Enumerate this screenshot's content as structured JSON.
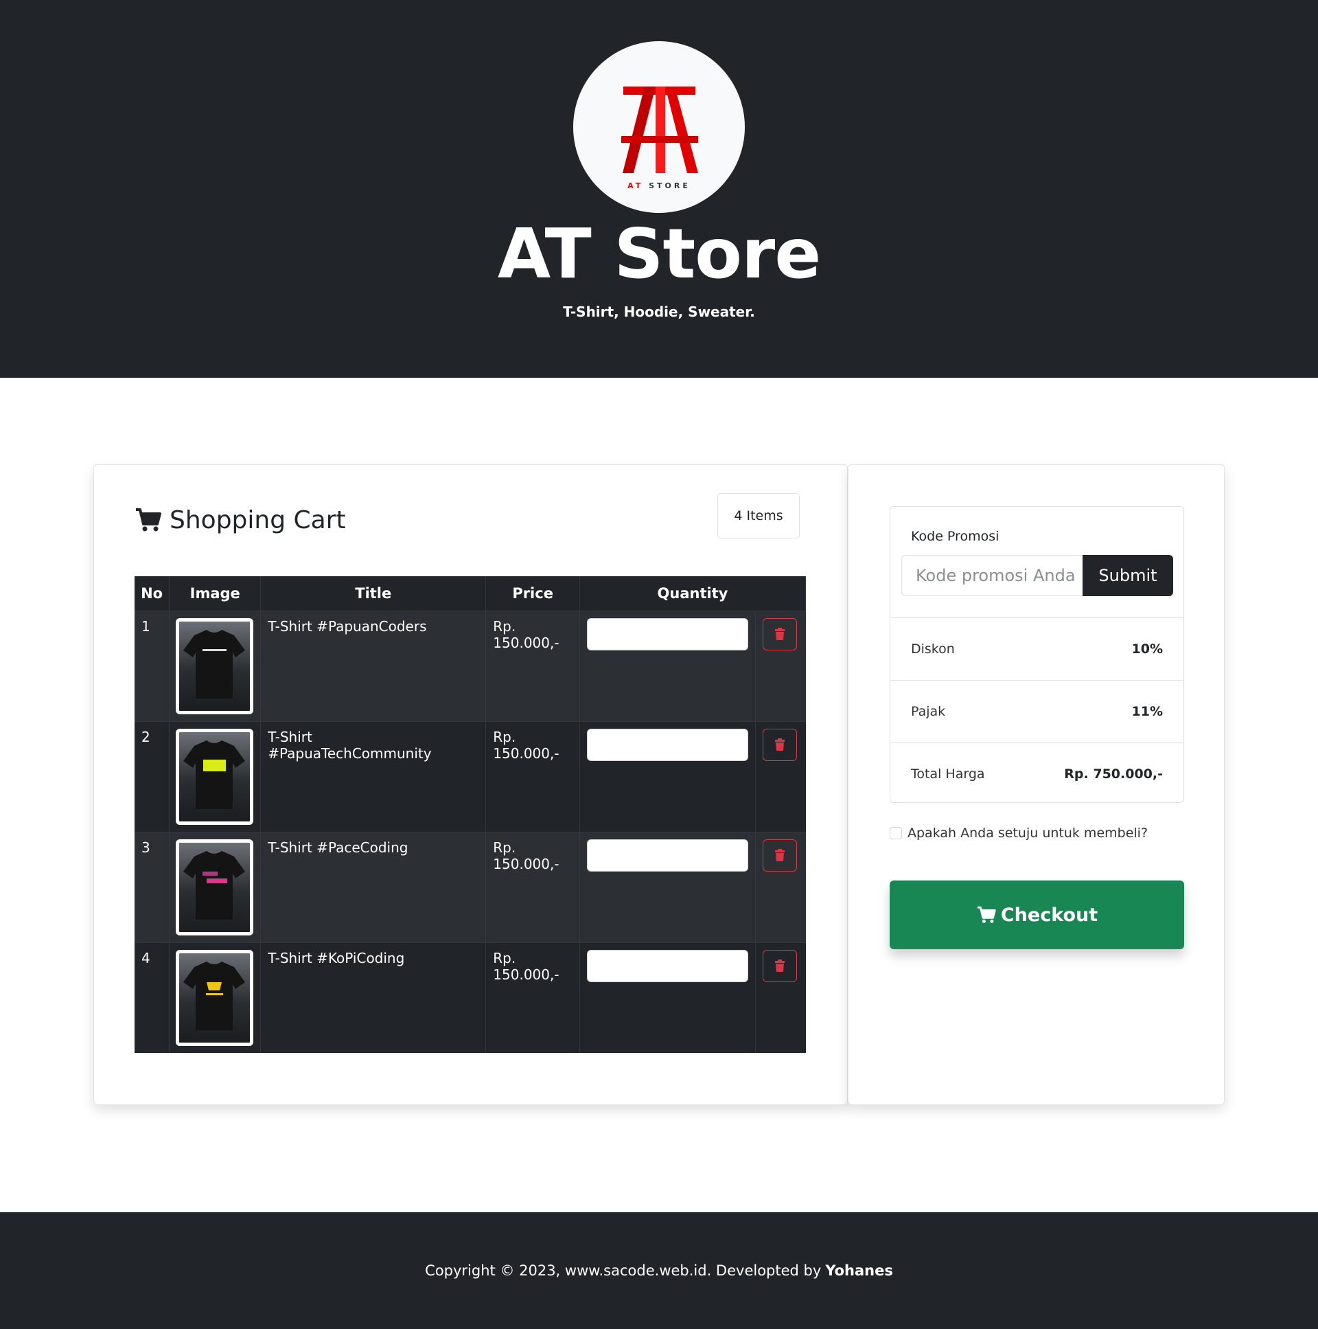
{
  "header": {
    "logo_sub_prefix": "AT",
    "logo_sub_rest": "STORE",
    "title": "AT Store",
    "tagline": "T-Shirt, Hoodie, Sweater."
  },
  "cart": {
    "title": "Shopping Cart",
    "items_badge": "4 Items",
    "columns": [
      "No",
      "Image",
      "Title",
      "Price",
      "Quantity"
    ],
    "rows": [
      {
        "no": "1",
        "title": "T-Shirt #PapuanCoders",
        "price_line1": "Rp.",
        "price_line2": "150.000,-",
        "quantity": ""
      },
      {
        "no": "2",
        "title": "T-Shirt #PapuaTechCommunity",
        "price_line1": "Rp.",
        "price_line2": "150.000,-",
        "quantity": ""
      },
      {
        "no": "3",
        "title": "T-Shirt #PaceCoding",
        "price_line1": "Rp.",
        "price_line2": "150.000,-",
        "quantity": ""
      },
      {
        "no": "4",
        "title": "T-Shirt #KoPiCoding",
        "price_line1": "Rp.",
        "price_line2": "150.000,-",
        "quantity": ""
      }
    ]
  },
  "summary": {
    "promo_label": "Kode Promosi",
    "promo_placeholder": "Kode promosi Anda",
    "submit_label": "Submit",
    "discount_label": "Diskon",
    "discount_value": "10%",
    "tax_label": "Pajak",
    "tax_value": "11%",
    "total_label": "Total Harga",
    "total_value": "Rp. 750.000,-",
    "agree_label": "Apakah Anda setuju untuk membeli?",
    "checkout_label": "Checkout"
  },
  "footer": {
    "copyright": "Copyright © 2023, www.sacode.web.id. Developted by",
    "author": "Yohanes"
  },
  "colors": {
    "dark": "#212529",
    "success": "#198754",
    "danger": "#dc3545",
    "logo_red": "#e00000"
  }
}
